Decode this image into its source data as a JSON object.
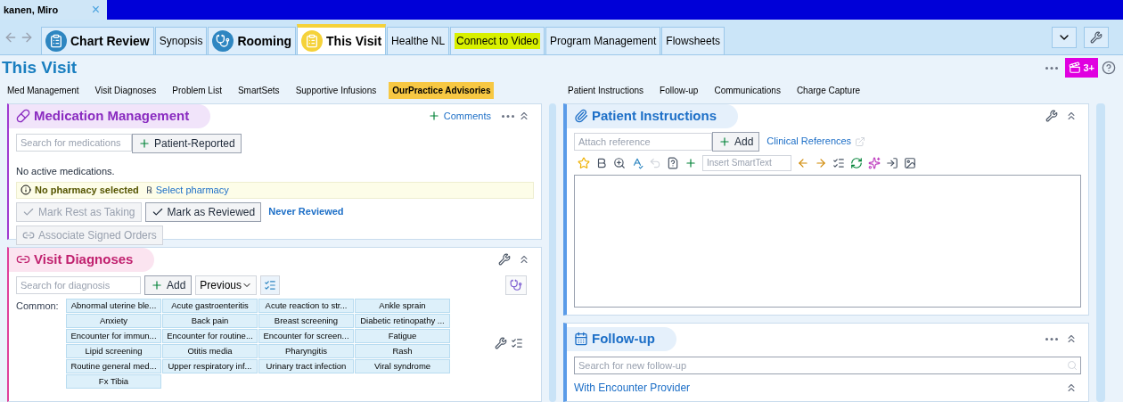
{
  "patient_tab": {
    "name": "kanen, Miro",
    "close": "×"
  },
  "tabs": [
    {
      "label": "Chart Review",
      "kind": "icon",
      "selected": false,
      "highlighted": false
    },
    {
      "label": "Synopsis",
      "kind": "plain",
      "selected": false,
      "highlighted": false
    },
    {
      "label": "Rooming",
      "kind": "icon",
      "selected": false,
      "highlighted": false
    },
    {
      "label": "This Visit",
      "kind": "icon",
      "selected": true,
      "highlighted": false
    },
    {
      "label": "Healthe NL",
      "kind": "plain",
      "selected": false,
      "highlighted": false
    },
    {
      "label": "Connect to Video",
      "kind": "plain",
      "selected": false,
      "highlighted": true
    },
    {
      "label": "Program Management",
      "kind": "plain",
      "selected": false,
      "highlighted": false
    },
    {
      "label": "Flowsheets",
      "kind": "plain",
      "selected": false,
      "highlighted": false
    }
  ],
  "page_title": "This Visit",
  "notification_badge": "3+",
  "left_links": [
    {
      "label": "Med Management",
      "highlighted": false
    },
    {
      "label": "Visit Diagnoses",
      "highlighted": false
    },
    {
      "label": "Problem List",
      "highlighted": false
    },
    {
      "label": "SmartSets",
      "highlighted": false
    },
    {
      "label": "Supportive Infusions",
      "highlighted": false
    },
    {
      "label": "OurPractice Advisories",
      "highlighted": true
    }
  ],
  "right_links": [
    {
      "label": "Patient Instructions",
      "highlighted": false
    },
    {
      "label": "Follow-up",
      "highlighted": false
    },
    {
      "label": "Communications",
      "highlighted": false
    },
    {
      "label": "Charge Capture",
      "highlighted": false
    }
  ],
  "medication_management": {
    "title": "Medication Management",
    "comments": "Comments",
    "search_placeholder": "Search for medications",
    "patient_reported": "Patient-Reported",
    "status": "No active medications.",
    "pharmacy_warning": "No pharmacy selected",
    "select_pharmacy": "Select pharmacy",
    "rx_symbol": "℞",
    "buttons": [
      {
        "label": "Mark Rest as Taking",
        "disabled": true
      },
      {
        "label": "Mark as Reviewed",
        "disabled": false
      }
    ],
    "review_status": "Never Reviewed",
    "associate": {
      "label": "Associate Signed Orders",
      "disabled": true
    }
  },
  "visit_diagnoses": {
    "title": "Visit Diagnoses",
    "search_placeholder": "Search for diagnosis",
    "add": "Add",
    "previous": "Previous",
    "common_label": "Common:",
    "common": [
      "Abnormal uterine ble...",
      "Acute gastroenteritis",
      "Acute reaction to str...",
      "Ankle sprain",
      "Anxiety",
      "Back pain",
      "Breast screening",
      "Diabetic retinopathy ...",
      "Encounter for immun...",
      "Encounter for routine...",
      "Encounter for screen...",
      "Fatigue",
      "Lipid screening",
      "Otitis media",
      "Pharyngitis",
      "Rash",
      "Routine general med...",
      "Upper respiratory inf...",
      "Urinary tract infection",
      "Viral syndrome",
      "Fx Tibia"
    ]
  },
  "patient_instructions": {
    "title": "Patient Instructions",
    "attach_placeholder": "Attach reference",
    "add": "Add",
    "clinical_references": "Clinical References",
    "smarttext_placeholder": "Insert SmartText"
  },
  "follow_up": {
    "title": "Follow-up",
    "search_placeholder": "Search for new follow-up",
    "section": "With Encounter Provider"
  }
}
